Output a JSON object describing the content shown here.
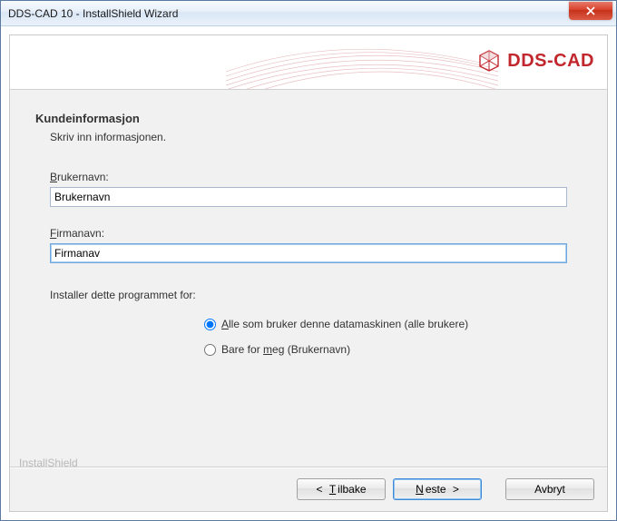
{
  "window": {
    "title": "DDS-CAD 10 - InstallShield Wizard"
  },
  "brand": {
    "name": "DDS-CAD"
  },
  "page": {
    "heading": "Kundeinformasjon",
    "subtext": "Skriv inn informasjonen."
  },
  "fields": {
    "user_label_u": "B",
    "user_label_rest": "rukernavn:",
    "user_value": "Brukernavn",
    "company_label_u": "F",
    "company_label_rest": "irmanavn:",
    "company_value": "Firmanav"
  },
  "install_for": {
    "label": "Installer dette programmet for:",
    "opt_all_u": "A",
    "opt_all_rest": "lle som bruker denne datamaskinen (alle brukere)",
    "opt_me_pre": "Bare for ",
    "opt_me_u": "m",
    "opt_me_post": "eg (Brukernavn)",
    "selected": "all"
  },
  "footer": {
    "brand": "InstallShield"
  },
  "buttons": {
    "back_sym": "<",
    "back_u": "T",
    "back_rest": "ilbake",
    "next_u": "N",
    "next_rest": "este",
    "next_sym": ">",
    "cancel": "Avbryt"
  }
}
